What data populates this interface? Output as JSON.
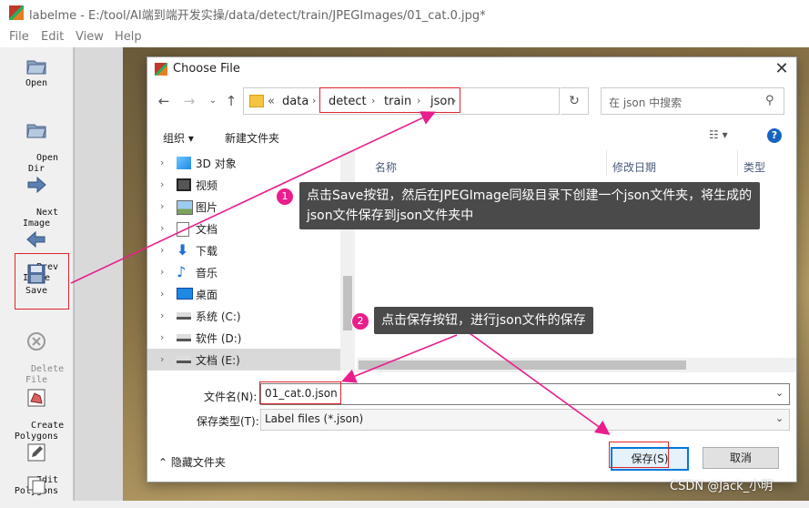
{
  "app": {
    "title": "labelme - E:/tool/AI端到端开发实操/data/detect/train/JPEGImages/01_cat.0.jpg*"
  },
  "menu": [
    "File",
    "Edit",
    "View",
    "Help"
  ],
  "tools": [
    {
      "label": "Open",
      "icon": "folder-open-icon",
      "enabled": true
    },
    {
      "label": "Open\nDir",
      "icon": "folder-open-icon",
      "enabled": true
    },
    {
      "label": "Next\nImage",
      "icon": "arrow-right-icon",
      "enabled": true
    },
    {
      "label": "Prev\nImage",
      "icon": "arrow-left-icon",
      "enabled": true
    },
    {
      "label": "Save",
      "icon": "floppy-disk-icon",
      "enabled": true
    },
    {
      "label": "Delete\nFile",
      "icon": "delete-icon",
      "enabled": false
    },
    {
      "label": "Create\nPolygons",
      "icon": "polygon-icon",
      "enabled": true
    },
    {
      "label": "Edit\nPolygons",
      "icon": "edit-icon",
      "enabled": true
    }
  ],
  "dialog": {
    "title": "Choose File",
    "address": {
      "prefix": "«",
      "crumbs": [
        "data",
        "detect",
        "train",
        "json"
      ]
    },
    "search_placeholder": "在 json 中搜索",
    "commands": {
      "organize": "组织 ▾",
      "new_folder": "新建文件夹"
    },
    "nav_items": [
      {
        "label": "3D 对象",
        "icon": "cube-icon"
      },
      {
        "label": "视频",
        "icon": "video-icon"
      },
      {
        "label": "图片",
        "icon": "picture-icon"
      },
      {
        "label": "文档",
        "icon": "document-icon"
      },
      {
        "label": "下载",
        "icon": "download-icon"
      },
      {
        "label": "音乐",
        "icon": "music-icon"
      },
      {
        "label": "桌面",
        "icon": "desktop-icon"
      },
      {
        "label": "系统 (C:)",
        "icon": "drive-icon"
      },
      {
        "label": "软件 (D:)",
        "icon": "drive-icon"
      },
      {
        "label": "文档 (E:)",
        "icon": "drive-icon",
        "selected": true
      }
    ],
    "columns": [
      "名称",
      "修改日期",
      "类型"
    ],
    "filename_label": "文件名(N):",
    "filename_value": "01_cat.0.json",
    "filetype_label": "保存类型(T):",
    "filetype_value": "Label files (*.json)",
    "hide_folders": "隐藏文件夹",
    "save_label": "保存(S)",
    "cancel_label": "取消"
  },
  "annotations": {
    "step1_number": "1",
    "step1_text": "点击Save按钮，然后在JPEGImage同级目录下创建一个json文件夹，将生成的json文件保存到json文件夹中",
    "step2_number": "2",
    "step2_text": "点击保存按钮，进行json文件的保存",
    "accent_color": "#e91e8c",
    "box_color": "#e0242c"
  },
  "watermark": "CSDN @Jack_小明"
}
